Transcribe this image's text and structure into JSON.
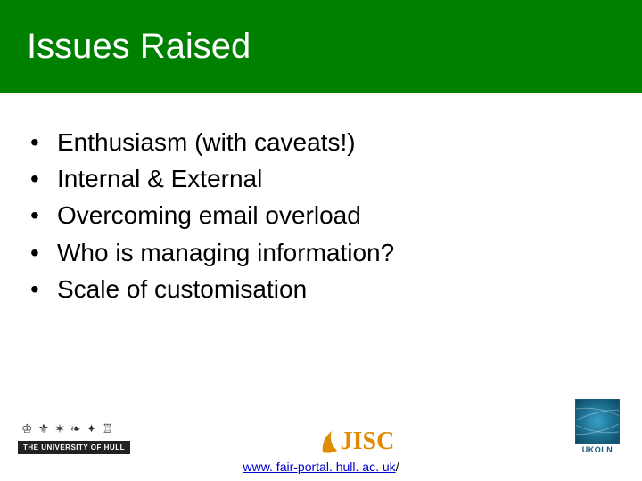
{
  "title": "Issues Raised",
  "bullets": {
    "b0": "Enthusiasm (with caveats!)",
    "b1": "Internal & External",
    "b2": "Overcoming email overload",
    "b3": "Who is managing information?",
    "b4": "Scale of customisation"
  },
  "logos": {
    "hull_label": "THE UNIVERSITY OF HULL",
    "jisc_label": "JISC",
    "ukoln_label": "UKOLN"
  },
  "footer": {
    "link_text": "www. fair-portal. hull. ac. uk",
    "link_suffix": "/",
    "link_href": "http://www.fair-portal.hull.ac.uk/"
  }
}
